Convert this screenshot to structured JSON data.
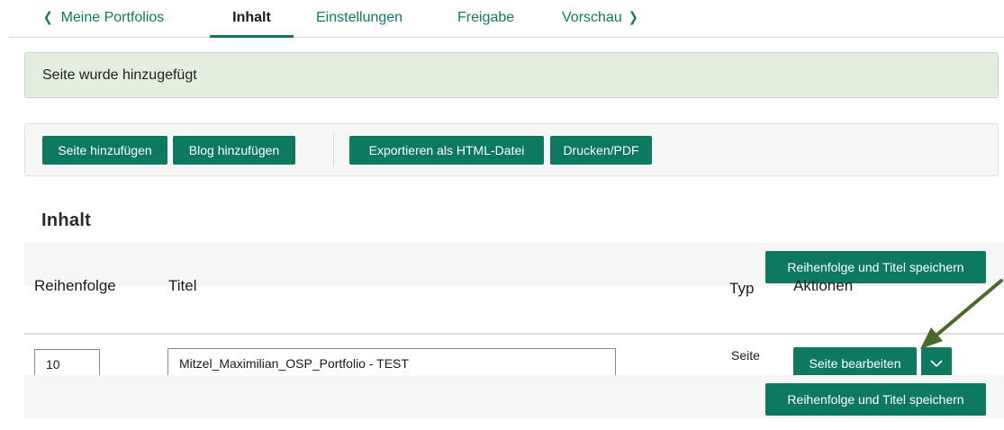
{
  "tabs": {
    "back": "Meine Portfolios",
    "active": "Inhalt",
    "settings": "Einstellungen",
    "share": "Freigabe",
    "preview": "Vorschau"
  },
  "notice": {
    "text": "Seite wurde hinzugefügt"
  },
  "toolbar": {
    "add_page": "Seite hinzufügen",
    "add_blog": "Blog hinzufügen",
    "export_html": "Exportieren als HTML-Datei",
    "print_pdf": "Drucken/PDF"
  },
  "content": {
    "title": "Inhalt",
    "save_button": "Reihenfolge und Titel speichern",
    "columns": {
      "order": "Reihenfolge",
      "title": "Titel",
      "type": "Typ",
      "actions": "Aktionen"
    },
    "rows": [
      {
        "order": "10",
        "title": "Mitzel_Maximilian_OSP_Portfolio - TEST",
        "type": "Seite",
        "edit_label": "Seite bearbeiten"
      }
    ]
  },
  "icons": {
    "back": "chevron-left-icon",
    "preview": "chevron-right-icon",
    "dropdown": "chevron-down-icon",
    "annotation": "arrow-pointer-icon"
  },
  "colors": {
    "accent": "#0d7a5f",
    "notice_bg": "#e4eedf",
    "annotation_arrow": "#4a6a2a"
  }
}
